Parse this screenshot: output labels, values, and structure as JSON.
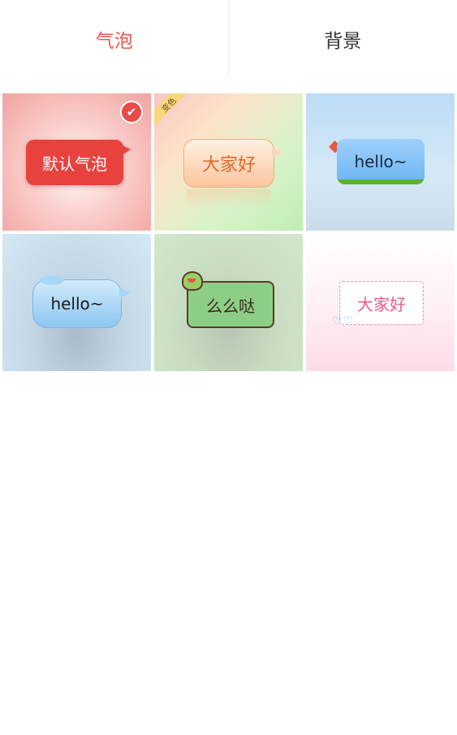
{
  "tabs": [
    {
      "label": "气泡",
      "active": true
    },
    {
      "label": "背景",
      "active": false
    }
  ],
  "colors": {
    "accent": "#e85a4f"
  },
  "bubbles": [
    {
      "text": "默认气泡",
      "selected": true,
      "selected_icon": "check-icon"
    },
    {
      "text": "大家好",
      "badge": "变色"
    },
    {
      "text": "hello~",
      "decoration": "kite-icon"
    },
    {
      "text": "hello~"
    },
    {
      "text": "么么哒",
      "decoration": "dino-icon"
    },
    {
      "text": "大家好",
      "decoration": "hearts-icon"
    }
  ]
}
